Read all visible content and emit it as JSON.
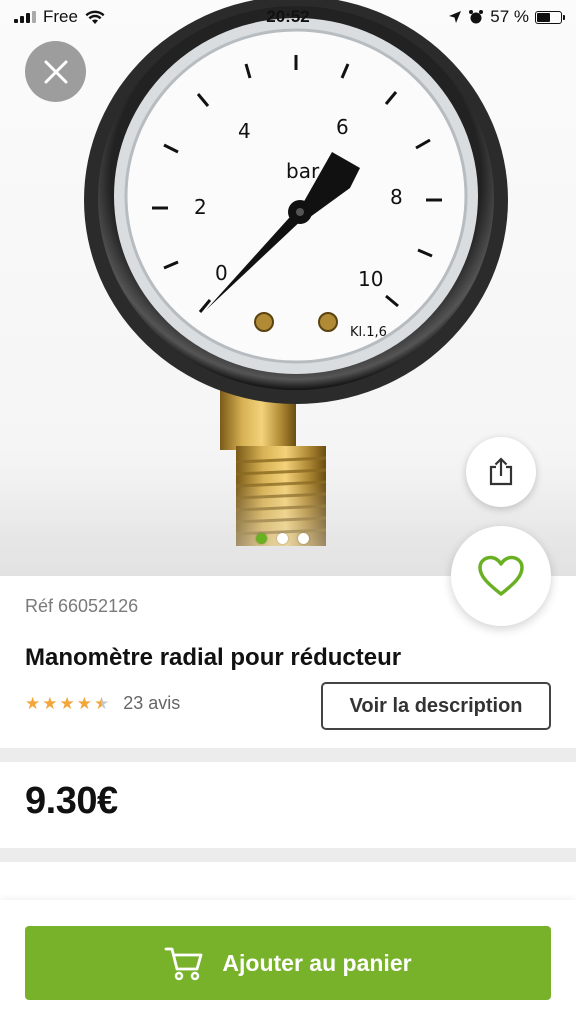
{
  "status_bar": {
    "carrier": "Free",
    "time": "20:52",
    "battery_percent": "57 %",
    "battery_level": 0.57,
    "icons": [
      "signal-icon",
      "wifi-icon",
      "location-icon",
      "alarm-icon",
      "battery-icon"
    ]
  },
  "product_image": {
    "gauge_unit": "bar",
    "gauge_scale": [
      "0",
      "2",
      "4",
      "6",
      "8",
      "10"
    ],
    "gauge_class": "Kl.1,6",
    "carousel_count": 3,
    "carousel_active_index": 0
  },
  "header_actions": {
    "close_icon": "close-icon",
    "share_icon": "share-icon",
    "favorite_icon": "heart-icon"
  },
  "product": {
    "reference": "Réf 66052126",
    "title": "Manomètre radial pour réducteur",
    "rating": 4.5,
    "rating_max": 5,
    "reviews": "23 avis",
    "description_button": "Voir la description",
    "price": "9.30€"
  },
  "cart": {
    "label": "Ajouter au panier",
    "icon": "cart-icon"
  },
  "colors": {
    "brand_green": "#78b22b",
    "star": "#f2a63b",
    "heart": "#6ab023"
  }
}
